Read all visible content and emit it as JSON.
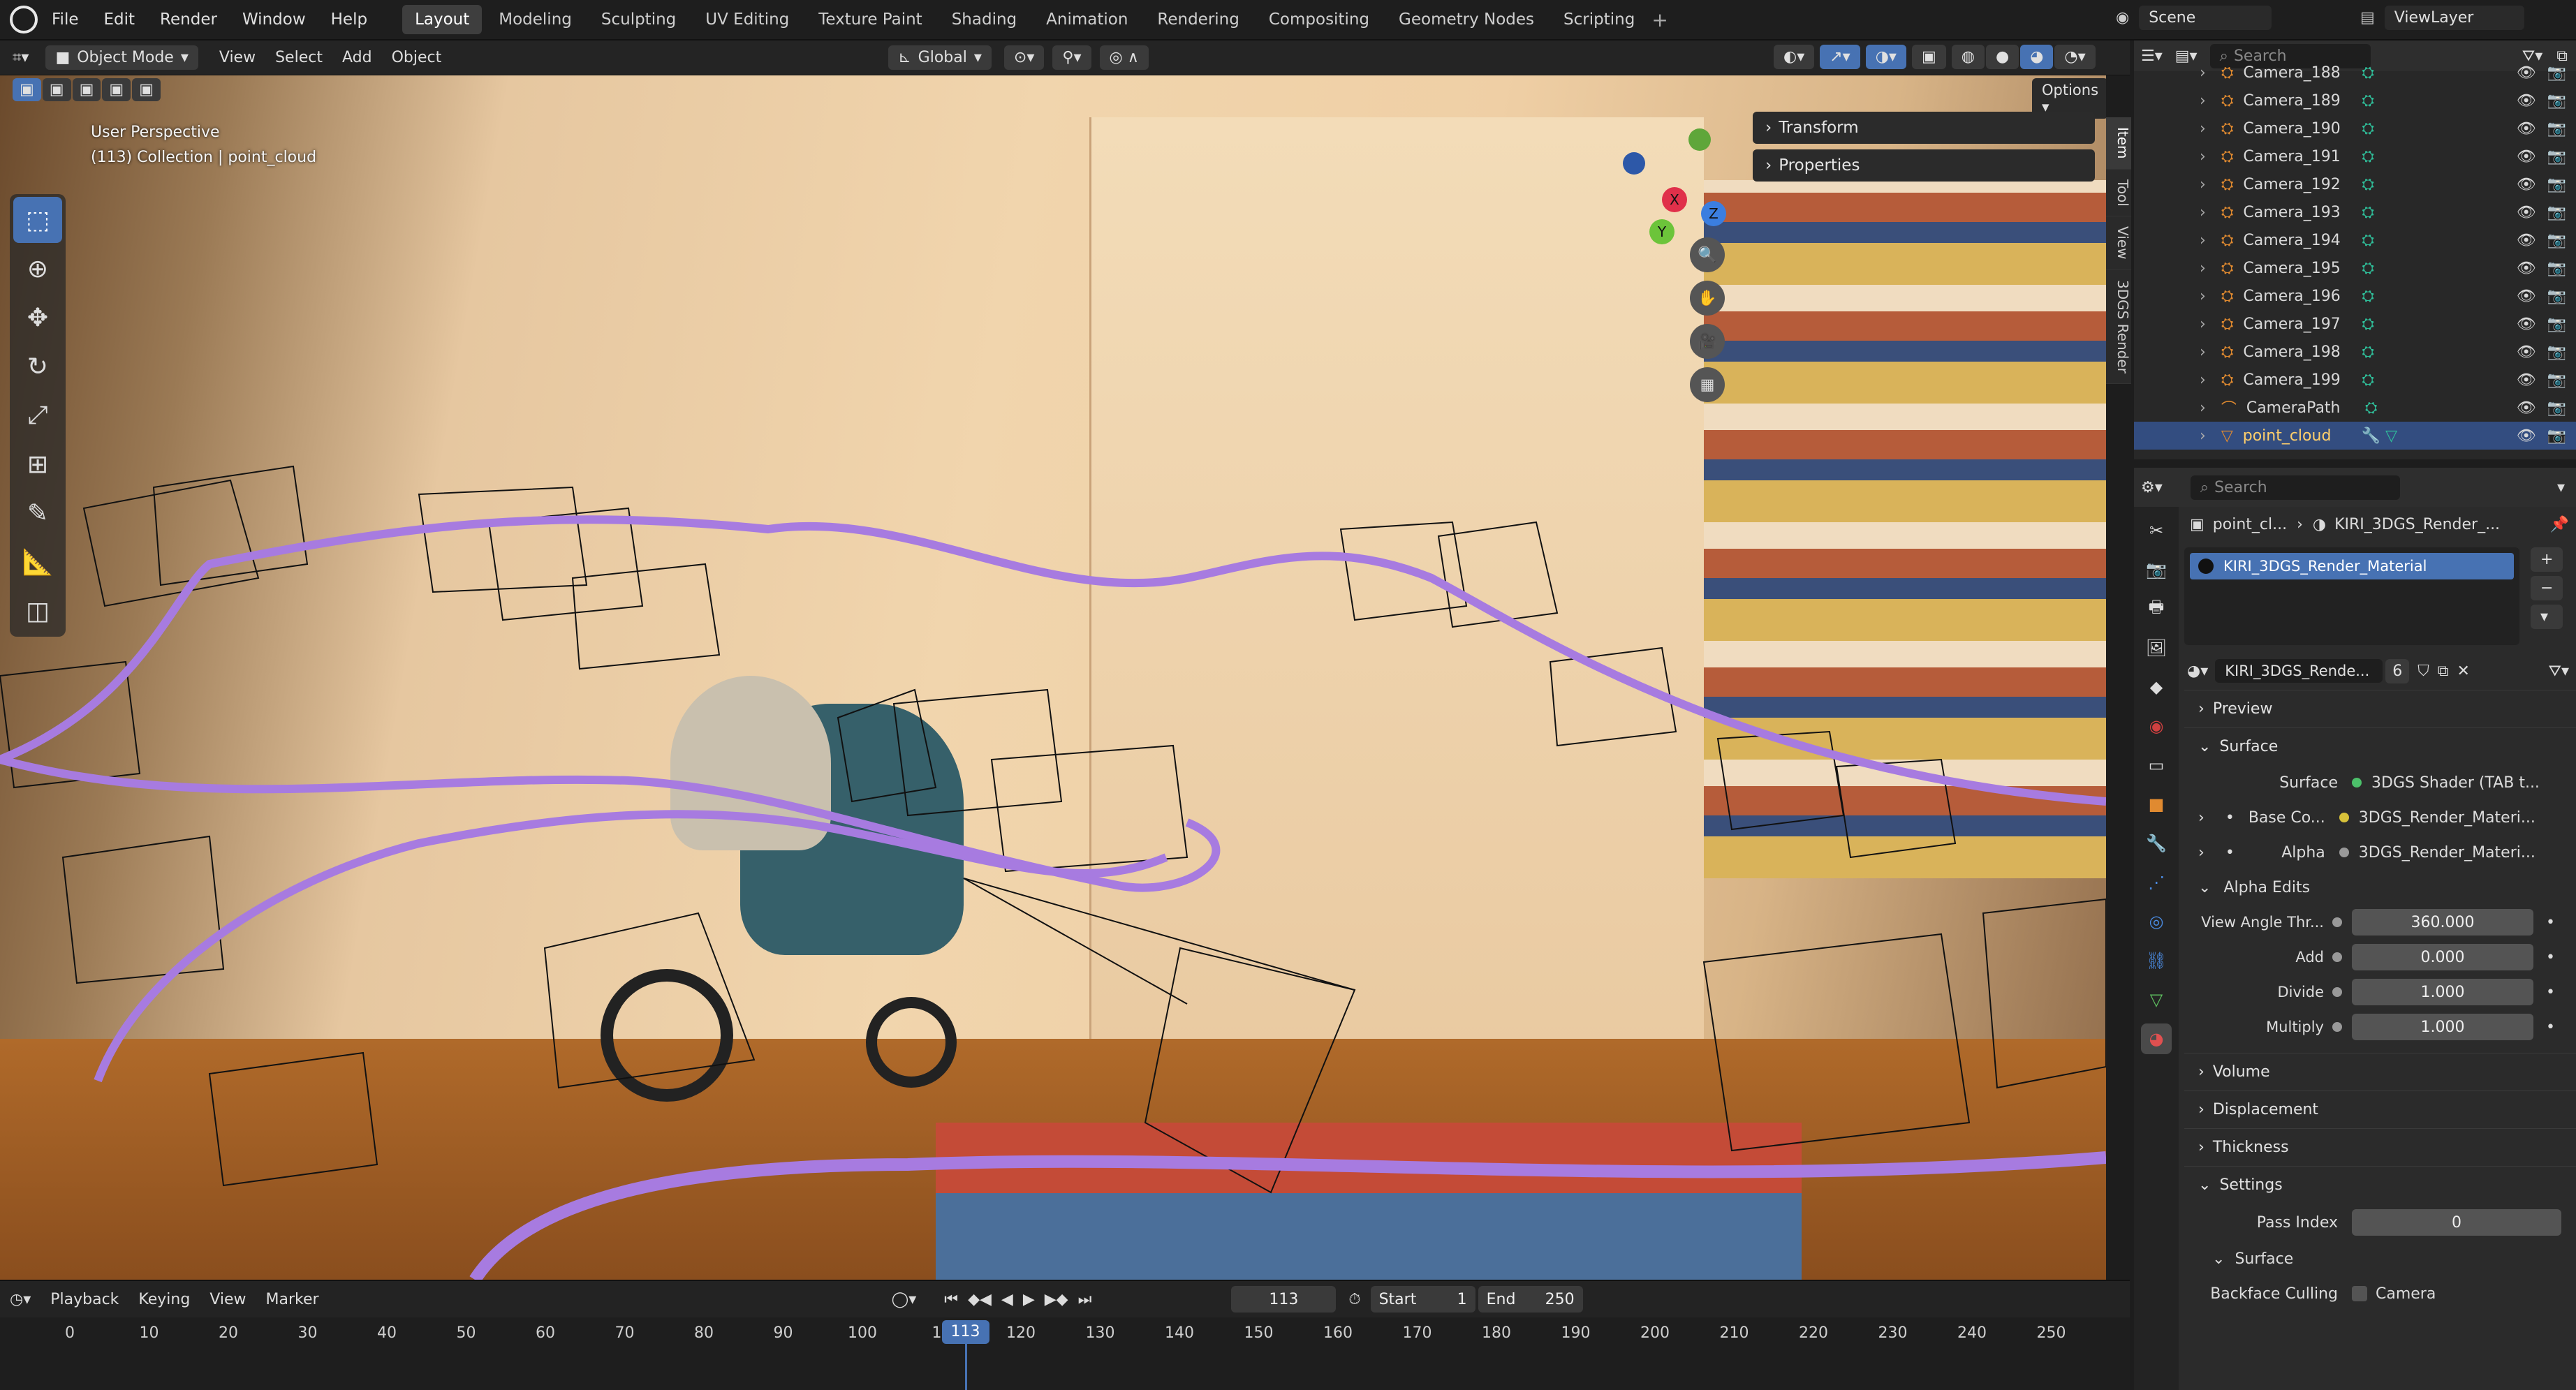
{
  "menu": [
    "File",
    "Edit",
    "Render",
    "Window",
    "Help"
  ],
  "workspaces": [
    "Layout",
    "Modeling",
    "Sculpting",
    "UV Editing",
    "Texture Paint",
    "Shading",
    "Animation",
    "Rendering",
    "Compositing",
    "Geometry Nodes",
    "Scripting"
  ],
  "active_workspace": "Layout",
  "scene": "Scene",
  "view_layer": "ViewLayer",
  "viewport_header": {
    "mode": "Object Mode",
    "menus": [
      "View",
      "Select",
      "Add",
      "Object"
    ],
    "transform": "Global",
    "options": "Options"
  },
  "viewport_overlay": {
    "line1": "User Perspective",
    "line2": "(113) Collection | point_cloud"
  },
  "gizmo": {
    "x": "X",
    "y": "Y",
    "z": "Z"
  },
  "npanel": {
    "transform": "Transform",
    "properties": "Properties",
    "tabs": [
      "Item",
      "Tool",
      "View",
      "3DGS Render"
    ]
  },
  "outliner": {
    "search_placeholder": "Search",
    "items": [
      "Camera_188",
      "Camera_189",
      "Camera_190",
      "Camera_191",
      "Camera_192",
      "Camera_193",
      "Camera_194",
      "Camera_195",
      "Camera_196",
      "Camera_197",
      "Camera_198",
      "Camera_199",
      "CameraPath",
      "point_cloud"
    ]
  },
  "properties": {
    "search_placeholder": "Search",
    "breadcrumb_object": "point_cl...",
    "breadcrumb_material": "KIRI_3DGS_Render_...",
    "material_slot": "KIRI_3DGS_Render_Material",
    "material_name": "KIRI_3DGS_Rende...",
    "user_count": "6",
    "sections": {
      "preview": "Preview",
      "surface": "Surface",
      "volume": "Volume",
      "displacement": "Displacement",
      "thickness": "Thickness",
      "settings": "Settings"
    },
    "surface_label": "Surface",
    "surface_value": "3DGS Shader (TAB t...",
    "base_color_label": "Base Co...",
    "base_color_value": "3DGS_Render_Materi...",
    "alpha_label": "Alpha",
    "alpha_value": "3DGS_Render_Materi...",
    "alpha_edits": "Alpha Edits",
    "view_angle_label": "View Angle Thr...",
    "view_angle_value": "360.000",
    "add_label": "Add",
    "add_value": "0.000",
    "divide_label": "Divide",
    "divide_value": "1.000",
    "multiply_label": "Multiply",
    "multiply_value": "1.000",
    "pass_index_label": "Pass Index",
    "pass_index_value": "0",
    "surface_sub": "Surface",
    "backface_label": "Backface Culling",
    "backface_value": "Camera"
  },
  "timeline": {
    "menus": [
      "Playback",
      "Keying",
      "View",
      "Marker"
    ],
    "current_frame": "113",
    "start_label": "Start",
    "start_value": "1",
    "end_label": "End",
    "end_value": "250",
    "ticks": [
      "0",
      "10",
      "20",
      "30",
      "40",
      "50",
      "60",
      "70",
      "80",
      "90",
      "100",
      "11",
      "120",
      "130",
      "140",
      "150",
      "160",
      "170",
      "180",
      "190",
      "200",
      "210",
      "220",
      "230",
      "240",
      "250"
    ],
    "playhead": "113"
  },
  "colors": {
    "accent": "#4772b3",
    "path": "#a77be0",
    "selected_row": "#334d80",
    "camera_icon": "#2fbf9a"
  }
}
